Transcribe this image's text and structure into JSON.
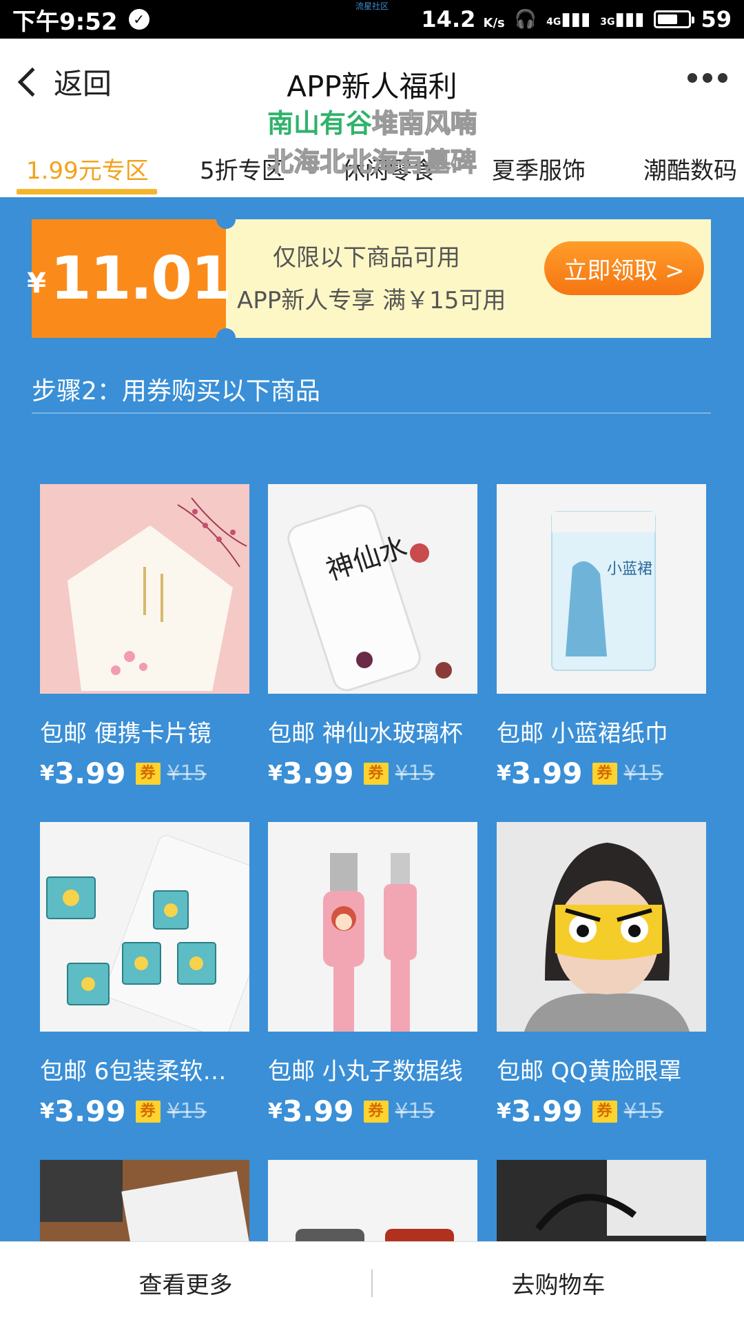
{
  "status_bar": {
    "time": "下午9:52",
    "center_label": "流星社区",
    "speed": "14.2",
    "speed_unit": "K/s",
    "network_1": "4G",
    "network_2": "3G",
    "battery": "59"
  },
  "header": {
    "back_label": "返回",
    "title": "APP新人福利",
    "watermark_line1_a": "南山有谷",
    "watermark_line1_b": "堆南风喃",
    "watermark_line2": "北海北北海有墓碑"
  },
  "tabs": [
    {
      "label": "1.99元专区",
      "active": true
    },
    {
      "label": "5折专区",
      "active": false
    },
    {
      "label": "休闲零食",
      "active": false
    },
    {
      "label": "夏季服饰",
      "active": false
    },
    {
      "label": "潮酷数码",
      "active": false
    }
  ],
  "coupon": {
    "currency": "¥",
    "amount": "11.01",
    "line1": "仅限以下商品可用",
    "line2": "APP新人专享 满￥15可用",
    "claim_button": "立即领取 >"
  },
  "step_title": "步骤2：用券购买以下商品",
  "products": [
    {
      "name": "包邮 便携卡片镜",
      "price": "3.99",
      "badge": "券",
      "original": "¥15",
      "image": "card-mirror"
    },
    {
      "name": "包邮 神仙水玻璃杯",
      "price": "3.99",
      "badge": "券",
      "original": "¥15",
      "image": "glass-cup",
      "img_text": "神仙水"
    },
    {
      "name": "包邮 小蓝裙纸巾",
      "price": "3.99",
      "badge": "券",
      "original": "¥15",
      "image": "tissue-pack",
      "img_text": "小蓝裙"
    },
    {
      "name": "包邮 6包装柔软纸…",
      "price": "3.99",
      "badge": "券",
      "original": "¥15",
      "image": "mini-tissues"
    },
    {
      "name": "包邮 小丸子数据线",
      "price": "3.99",
      "badge": "券",
      "original": "¥15",
      "image": "data-cable"
    },
    {
      "name": "包邮 QQ黄脸眼罩",
      "price": "3.99",
      "badge": "券",
      "original": "¥15",
      "image": "eye-mask"
    },
    {
      "image": "notebook"
    },
    {
      "image": "phone-cases"
    },
    {
      "image": "cable-cord"
    }
  ],
  "bottom_bar": {
    "more_label": "查看更多",
    "cart_label": "去购物车"
  },
  "colors": {
    "background": "#3a8fd6",
    "accent_orange": "#fa8b1a",
    "tab_active": "#f2a21a",
    "coupon_bg": "#fdf7c6",
    "badge_yellow": "#fdd330"
  }
}
